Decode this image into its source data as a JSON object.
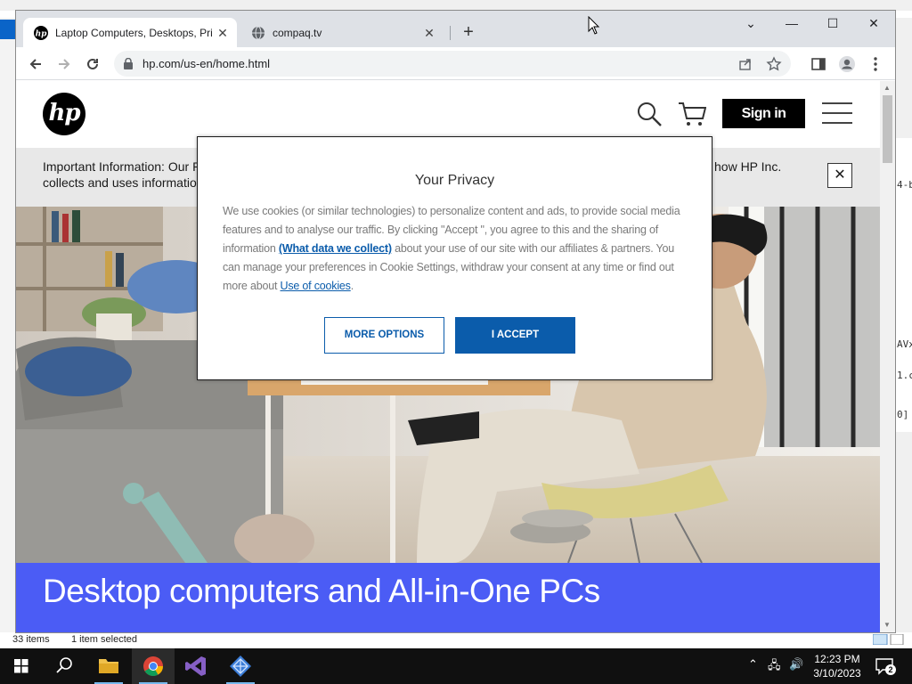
{
  "desktop": {
    "explorer_status": {
      "items_count": "33 items",
      "selected": "1 item selected"
    },
    "side_text": [
      "4-b",
      "AVx",
      "1.c",
      "0]"
    ]
  },
  "browser": {
    "tabs": [
      {
        "title": "Laptop Computers, Desktops, Pri",
        "active": true,
        "favicon": "hp-favicon"
      },
      {
        "title": "compaq.tv",
        "active": false,
        "favicon": "globe-icon"
      }
    ],
    "new_tab_label": "+",
    "url": "hp.com/us-en/home.html",
    "window_controls": [
      "chevron-down",
      "minimize",
      "maximize",
      "close"
    ]
  },
  "page": {
    "logo_text": "hp",
    "sign_in": "Sign in",
    "info_bar": {
      "line1_start": "Important Information: Our P",
      "line1_end": "how HP Inc.",
      "line2_start": "collects and uses informatio"
    },
    "hero_title": "Desktop computers and All-in-One PCs"
  },
  "privacy_dialog": {
    "title": "Your Privacy",
    "body_1": "We use cookies (or similar technologies) to personalize content and ads, to provide social media features and to analyse our traffic. By clicking \"Accept \", you agree to this and the sharing of information ",
    "link_data": "(What data we collect)",
    "body_2": " about your use of our site with our affiliates & partners. You can manage your preferences in Cookie Settings, withdraw your consent at any time or find out more about ",
    "link_cookies": "Use of cookies",
    "body_3": ".",
    "more_options": "MORE OPTIONS",
    "accept": "I ACCEPT"
  },
  "taskbar": {
    "time": "12:23 PM",
    "date": "3/10/2023",
    "notification_count": "2",
    "apps": [
      "start",
      "search",
      "file-explorer",
      "chrome",
      "visual-studio",
      "app"
    ]
  },
  "colors": {
    "hp_blue_banner": "#4b5cf5",
    "accept_blue": "#0b5cab",
    "taskbar": "#101010"
  }
}
